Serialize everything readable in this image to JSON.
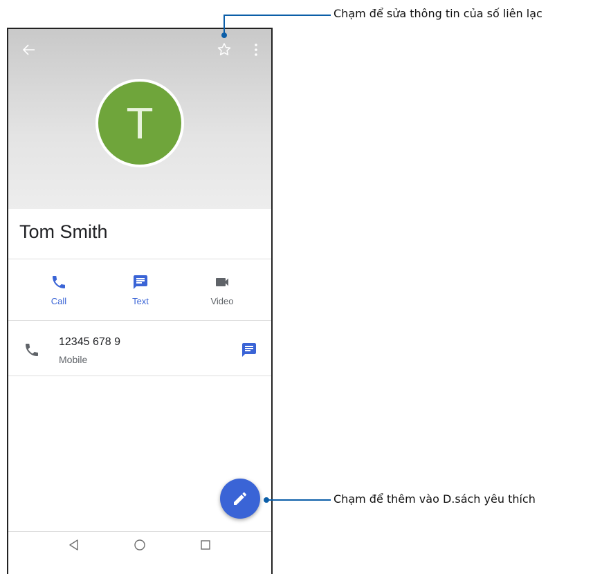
{
  "contact": {
    "initial": "T",
    "name": "Tom Smith",
    "avatar_color": "#6fa53b",
    "phone_number": "12345 678 9",
    "phone_type": "Mobile"
  },
  "actions": [
    {
      "label": "Call",
      "icon": "phone-icon",
      "color": "#3a64d6"
    },
    {
      "label": "Text",
      "icon": "message-icon",
      "color": "#3a64d6"
    },
    {
      "label": "Video",
      "icon": "videocam-icon",
      "color": "#5f6368"
    }
  ],
  "callouts": {
    "top": "Chạm để sửa thông tin của số liên lạc",
    "bottom": "Chạm để thêm vào D.sách yêu thích"
  },
  "colors": {
    "accent": "#3a64d6",
    "callout": "#0b5ea8"
  }
}
